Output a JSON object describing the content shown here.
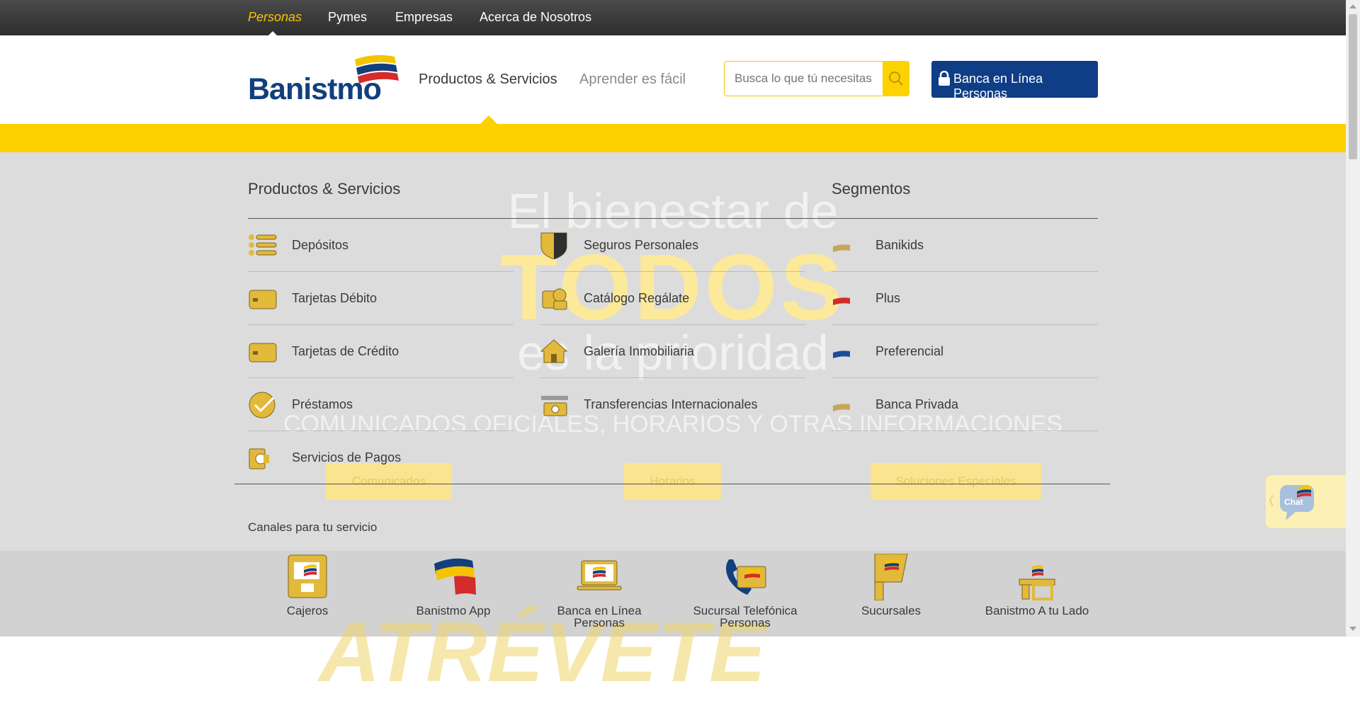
{
  "topnav": [
    "Personas",
    "Pymes",
    "Empresas",
    "Acerca de Nosotros"
  ],
  "logo": "Banistmo",
  "mainnav": [
    "Productos & Servicios",
    "Aprender es fácil"
  ],
  "search": {
    "placeholder": "Busca lo que tú necesitas"
  },
  "online_button": "Banca en Línea Personas",
  "hero": {
    "line1": "El bienestar de",
    "line2": "TODOS",
    "line3": "es la prioridad",
    "line4": "COMUNICADOS OFICIALES, HORARIOS Y OTRAS INFORMACIONES",
    "buttons": [
      "Comunicados",
      "Horarios",
      "Soluciones Especiales"
    ],
    "watermark": "ATRÉVETE"
  },
  "menu": {
    "products_title": "Productos & Servicios",
    "segments_title": "Segmentos",
    "col1": [
      {
        "label": "Depósitos",
        "icon": "list-icon"
      },
      {
        "label": "Tarjetas Débito",
        "icon": "debit-card-icon"
      },
      {
        "label": "Tarjetas de Crédito",
        "icon": "credit-card-icon"
      },
      {
        "label": "Préstamos",
        "icon": "check-circle-icon"
      },
      {
        "label": "Servicios de Pagos",
        "icon": "payments-icon"
      }
    ],
    "col2": [
      {
        "label": "Seguros Personales",
        "icon": "shield-icon"
      },
      {
        "label": "Catálogo Regálate",
        "icon": "gift-catalog-icon"
      },
      {
        "label": "Galería Inmobiliaria",
        "icon": "house-icon"
      },
      {
        "label": "Transferencias Internacionales",
        "icon": "transfer-icon"
      }
    ],
    "segments": [
      {
        "label": "Banikids",
        "color": "#c8a55a"
      },
      {
        "label": "Plus",
        "color": "#d42b2b"
      },
      {
        "label": "Preferencial",
        "color": "#1d4d9a"
      },
      {
        "label": "Banca Privada",
        "color": "#c8a55a"
      }
    ],
    "channels_title": "Canales para tu servicio",
    "channels": [
      {
        "label": "Cajeros",
        "icon": "atm-icon"
      },
      {
        "label": "Banistmo App",
        "icon": "app-icon"
      },
      {
        "label": "Banca en Línea Personas",
        "icon": "laptop-icon"
      },
      {
        "label": "Sucursal Telefónica Personas",
        "icon": "phone-icon"
      },
      {
        "label": "Sucursales",
        "icon": "branch-icon"
      },
      {
        "label": "Banistmo A tu Lado",
        "icon": "agent-icon"
      }
    ]
  },
  "chat": {
    "label": "Chat"
  }
}
